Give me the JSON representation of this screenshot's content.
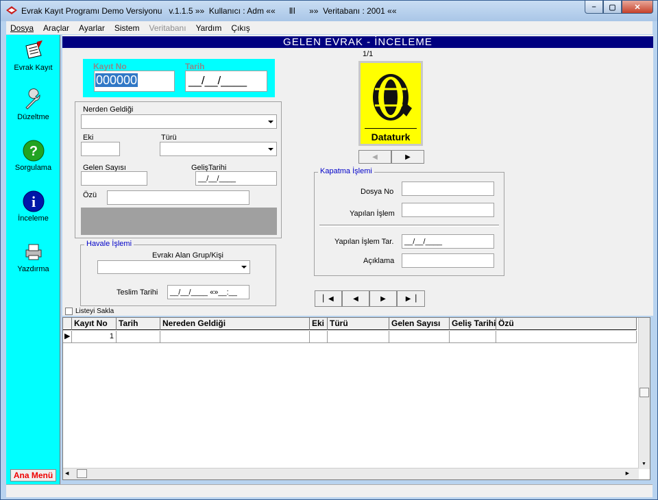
{
  "window": {
    "title": "Evrak Kayıt Programı Demo Versiyonu   v.1.1.5 »»  Kullanıcı : Adm ««      ⅡⅠ      »»  Veritabanı : 2001 ««",
    "min": "–",
    "max": "▢",
    "close": "✕"
  },
  "menu": [
    "Dosya",
    "Araçlar",
    "Ayarlar",
    "Sistem",
    "Veritabanı",
    "Yardım",
    "Çıkış"
  ],
  "sidebar": {
    "items": [
      "Evrak Kayıt",
      "Düzeltme",
      "Sorgulama",
      "İnceleme",
      "Yazdırma"
    ],
    "ana_menu": "Ana Menü"
  },
  "header": "GELEN EVRAK - İNCELEME",
  "page_counter": "1/1",
  "form": {
    "kayit_no_label": "Kayıt No",
    "kayit_no_value": "000000",
    "tarih_label": "Tarih",
    "tarih_value": "__/__/____",
    "nerden_label": "Nerden Geldiği",
    "eki_label": "Eki",
    "turu_label": "Türü",
    "gelen_sayisi_label": "Gelen Sayısı",
    "gelis_tarihi_label": "GelişTarihi",
    "gelis_tarihi_value": "__/__/____",
    "ozu_label": "Özü"
  },
  "havale": {
    "caption": "Havale İşlemi",
    "alan_label": "Evrakı Alan Grup/Kişi",
    "teslim_label": "Teslim Tarihi",
    "teslim_value": "__/__/____ «»__:__"
  },
  "logo": {
    "text": "Dataturk"
  },
  "kapatma": {
    "caption": "Kapatma İşlemi",
    "dosya_no": "Dosya No",
    "yapilan_islem": "Yapılan İşlem",
    "yapilan_islem_tar": "Yapılan İşlem Tar.",
    "yapilan_islem_tar_value": "__/__/____",
    "aciklama": "Açıklama"
  },
  "listeyi_sakla": "Listeyi Sakla",
  "grid": {
    "columns": [
      "Kayıt No",
      "Tarih",
      "Nereden Geldiği",
      "Eki",
      "Türü",
      "Gelen Sayısı",
      "Geliş Tarihi",
      "Özü"
    ],
    "rows": [
      [
        "1",
        "",
        "",
        "",
        "",
        "",
        "",
        ""
      ]
    ]
  },
  "colors": {
    "accent_cyan": "#00ffff",
    "header_navy": "#000080",
    "logo_yellow": "#ffff00",
    "anamenu_red": "#e00000"
  }
}
